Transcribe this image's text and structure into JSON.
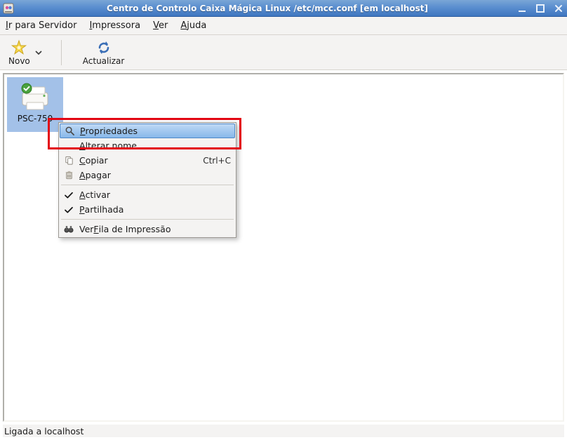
{
  "window": {
    "title": "Centro de Controlo Caixa Mágica Linux /etc/mcc.conf [em localhost]"
  },
  "menubar": {
    "go_server": {
      "u": "I",
      "rest": "r para Servidor"
    },
    "printer": {
      "u": "I",
      "rest": "mpressora"
    },
    "view": {
      "u": "V",
      "rest": "er"
    },
    "help": {
      "u": "A",
      "rest": "juda"
    }
  },
  "toolbar": {
    "new_label": "Novo",
    "refresh_label": "Actualizar"
  },
  "printer_item": {
    "label": "PSC-750"
  },
  "context_menu": {
    "properties": "Propriedades",
    "rename": "Alterar nome",
    "copy": "Copiar",
    "copy_accel": "Ctrl+C",
    "delete": "Apagar",
    "activate": "Activar",
    "shared": "Partilhada",
    "view_queue": "Ver Fila de Impressão",
    "u_properties": "P",
    "rest_properties": "ropriedades",
    "u_rename": "A",
    "rest_rename": "lterar nome",
    "u_copy": "C",
    "rest_copy": "opiar",
    "u_delete": "A",
    "rest_delete": "pagar",
    "u_activate": "A",
    "rest_activate": "ctivar",
    "u_shared": "P",
    "rest_shared": "artilhada",
    "pre_viewq": "Ver ",
    "u_viewq": "F",
    "rest_viewq": "ila de Impressão"
  },
  "statusbar": {
    "text": "Ligada a localhost"
  }
}
